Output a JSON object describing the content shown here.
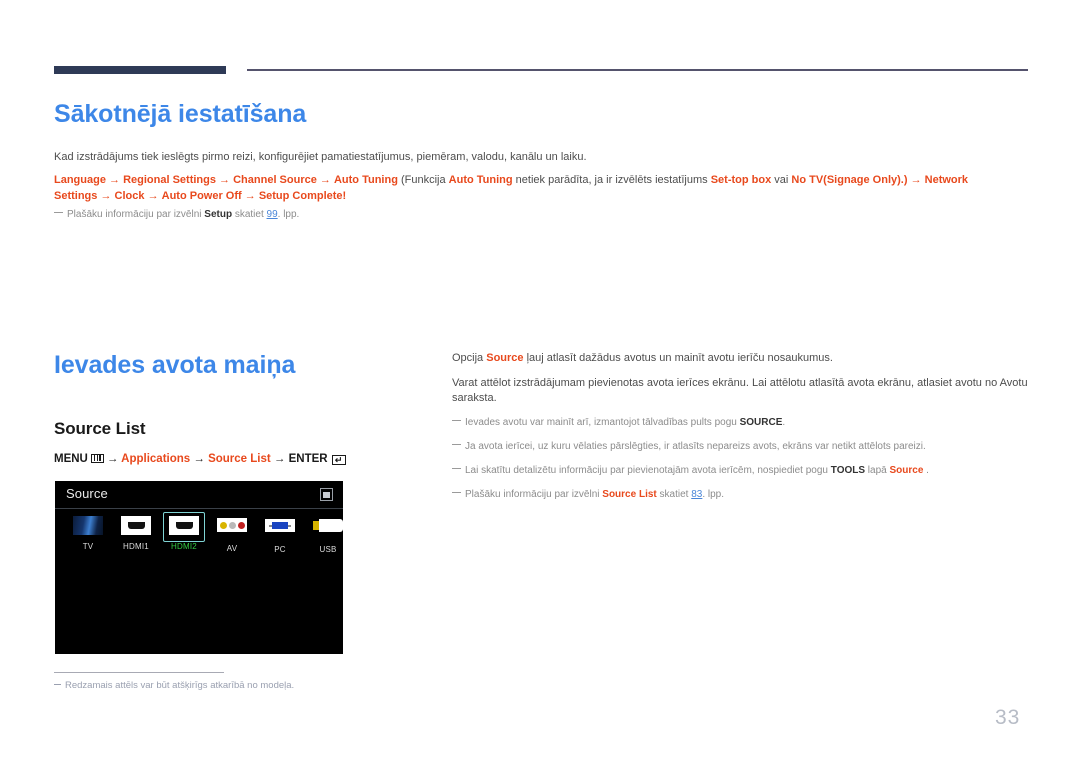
{
  "header": {
    "rule_color_thick": "#2e3a56",
    "rule_color_thin": "#55536d"
  },
  "section1": {
    "heading": "Sākotnējā iestatīšana",
    "intro": "Kad izstrādājums tiek ieslēgts pirmo reizi, konfigurējiet pamatiestatījumus, piemēram, valodu, kanālu un laiku.",
    "flow": {
      "s1": "Language",
      "a1": "→",
      "s2": "Regional Settings",
      "a2": "→",
      "s3": "Channel Source",
      "a3": "→",
      "s4": "Auto Tuning",
      "t1": "(Funkcija",
      "s5": "Auto Tuning",
      "t2": "netiek parādīta, ja ir izvēlēts iestatījums",
      "s6": "Set-top box",
      "t3": "vai",
      "s7": "No TV(Signage Only).)",
      "a4": "→",
      "s8": "Network Settings",
      "a5": "→",
      "s9": "Clock",
      "a6": "→",
      "s10": "Auto Power Off",
      "a7": "→",
      "s11": "Setup Complete!"
    },
    "note": {
      "t1": "Plašāku informāciju par izvēlni ",
      "kw": "Setup",
      "t2": " skatiet ",
      "page_ref": "99",
      "t3": ". lpp."
    }
  },
  "section2": {
    "heading": "Ievades avota maiņa",
    "subheading": "Source List",
    "menu_path": {
      "menu": "MENU",
      "menu_icon": "menu-grid-icon",
      "a1": "→",
      "p1": "Applications",
      "a2": "→",
      "p2": "Source List",
      "a3": "→",
      "enter": "ENTER",
      "enter_icon": "enter-return-icon"
    },
    "tv_panel": {
      "title": "Source",
      "corner_icon": "window-restore-icon",
      "sources": [
        {
          "label": "TV",
          "icon": "tv-screen-icon",
          "selected": false
        },
        {
          "label": "HDMI1",
          "icon": "hdmi-port-icon",
          "selected": false
        },
        {
          "label": "HDMI2",
          "icon": "hdmi-port-icon",
          "selected": true
        },
        {
          "label": "AV",
          "icon": "rca-jacks-icon",
          "selected": false
        },
        {
          "label": "PC",
          "icon": "vga-port-icon",
          "selected": false
        },
        {
          "label": "USB",
          "icon": "usb-plug-icon",
          "selected": false
        }
      ],
      "selected_color": "#33cc44",
      "focus_color": "#7fd4d4"
    },
    "footnote": "Redzamais attēls var būt atšķirīgs atkarībā no modeļa."
  },
  "right_column": {
    "lead1": {
      "t1": "Opcija ",
      "kw": "Source",
      "t2": " ļauj atlasīt dažādus avotus un mainīt avotu ierīču nosaukumus."
    },
    "lead2": "Varat attēlot izstrādājumam pievienotas avota ierīces ekrānu. Lai attēlotu atlasītā avota ekrānu, atlasiet avotu no Avotu saraksta.",
    "notes": [
      {
        "t1": "Ievades avotu var mainīt arī, izmantojot tālvadības pults pogu ",
        "b1": "SOURCE",
        "t2": "."
      },
      {
        "t1": "Ja avota ierīcei, uz kuru vēlaties pārslēgties, ir atlasīts nepareizs avots, ekrāns var netikt attēlots pareizi.",
        "b1": "",
        "t2": ""
      },
      {
        "t1": "Lai skatītu detalizētu informāciju par pievienotajām avota ierīcēm, nospiediet pogu ",
        "b1": "TOOLS",
        "t2": " lapā ",
        "b2": "Source",
        "t3": " ."
      },
      {
        "t1": "Plašāku informāciju par izvēlni ",
        "b2": "Source List",
        "t2": " skatiet ",
        "page_ref": "83",
        "t3": ". lpp."
      }
    ]
  },
  "page_number": "33",
  "colors": {
    "heading_blue": "#3d87e8",
    "keyword_red": "#e8491d",
    "body_gray": "#4d4d4d",
    "note_gray": "#8c8c8c",
    "link_blue": "#4a86d8"
  }
}
